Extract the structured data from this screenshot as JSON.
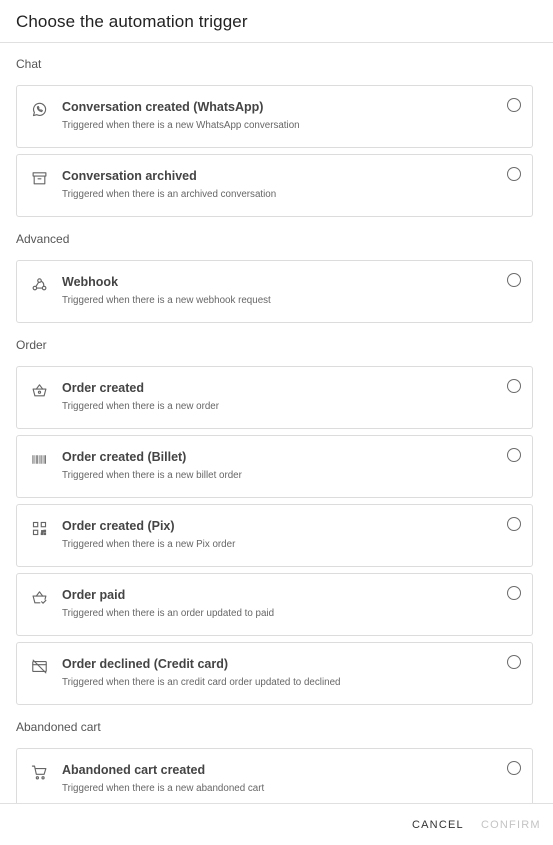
{
  "dialog": {
    "title": "Choose the automation trigger"
  },
  "sections": [
    {
      "label": "Chat",
      "items": [
        {
          "title": "Conversation created (WhatsApp)",
          "description": "Triggered when there is a new WhatsApp conversation",
          "icon": "whatsapp-icon",
          "selected": false
        },
        {
          "title": "Conversation archived",
          "description": "Triggered when there is an archived conversation",
          "icon": "archive-icon",
          "selected": false
        }
      ]
    },
    {
      "label": "Advanced",
      "items": [
        {
          "title": "Webhook",
          "description": "Triggered when there is a new webhook request",
          "icon": "webhook-icon",
          "selected": false
        }
      ]
    },
    {
      "label": "Order",
      "items": [
        {
          "title": "Order created",
          "description": "Triggered when there is a new order",
          "icon": "basket-icon",
          "selected": false
        },
        {
          "title": "Order created (Billet)",
          "description": "Triggered when there is a new billet order",
          "icon": "barcode-icon",
          "selected": false
        },
        {
          "title": "Order created (Pix)",
          "description": "Triggered when there is a new Pix order",
          "icon": "qrcode-icon",
          "selected": false
        },
        {
          "title": "Order paid",
          "description": "Triggered when there is an order updated to paid",
          "icon": "basket-check-icon",
          "selected": false
        },
        {
          "title": "Order declined (Credit card)",
          "description": "Triggered when there is an credit card order updated to declined",
          "icon": "credit-card-off-icon",
          "selected": false
        }
      ]
    },
    {
      "label": "Abandoned cart",
      "items": [
        {
          "title": "Abandoned cart created",
          "description": "Triggered when there is a new abandoned cart",
          "icon": "cart-icon",
          "selected": false
        }
      ]
    }
  ],
  "footer": {
    "cancel_label": "CANCEL",
    "confirm_label": "CONFIRM",
    "confirm_enabled": false
  },
  "colors": {
    "border": "#dcdcdc",
    "text": "#444444",
    "disabled": "#c4c4c4"
  }
}
